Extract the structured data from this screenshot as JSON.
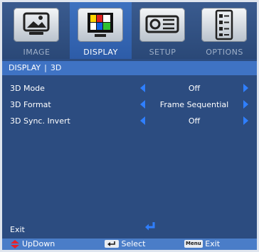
{
  "tabs": [
    {
      "label": "IMAGE",
      "icon": "image-icon",
      "active": false
    },
    {
      "label": "DISPLAY",
      "icon": "display-icon",
      "active": true
    },
    {
      "label": "SETUP",
      "icon": "projector-icon",
      "active": false
    },
    {
      "label": "OPTIONS",
      "icon": "options-icon",
      "active": false
    }
  ],
  "breadcrumb": {
    "section": "DISPLAY",
    "separator": "|",
    "page": "3D"
  },
  "rows": [
    {
      "name": "3D Mode",
      "value": "Off"
    },
    {
      "name": "3D Format",
      "value": "Frame Sequential"
    },
    {
      "name": "3D Sync. Invert",
      "value": "Off"
    }
  ],
  "exit_label": "Exit",
  "footer": {
    "updown_label": "UpDown",
    "select_label": "Select",
    "menu_key": "Menu",
    "menu_exit_label": "Exit"
  },
  "colors": {
    "panel": "#2c4c80",
    "active_tab": "#3e72c0",
    "arrow": "#2f7fff",
    "footer": "#4a7dc8"
  }
}
